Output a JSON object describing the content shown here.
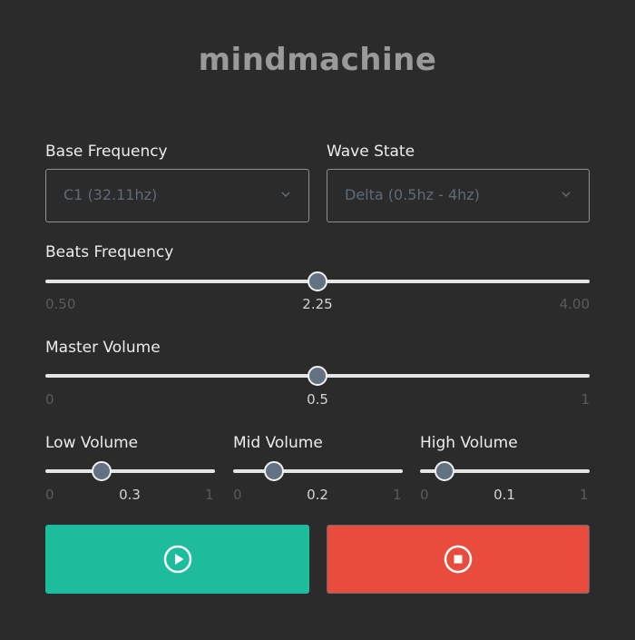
{
  "app": {
    "title": "mindmachine"
  },
  "base_frequency": {
    "label": "Base Frequency",
    "selected": "C1 (32.11hz)"
  },
  "wave_state": {
    "label": "Wave State",
    "selected": "Delta (0.5hz - 4hz)"
  },
  "beats_frequency": {
    "label": "Beats Frequency",
    "min": "0.50",
    "max": "4.00",
    "value": "2.25"
  },
  "master_volume": {
    "label": "Master Volume",
    "min": "0",
    "max": "1",
    "value": "0.5"
  },
  "low_volume": {
    "label": "Low Volume",
    "min": "0",
    "max": "1",
    "value": "0.3"
  },
  "mid_volume": {
    "label": "Mid Volume",
    "min": "0",
    "max": "1",
    "value": "0.2"
  },
  "high_volume": {
    "label": "High Volume",
    "min": "0",
    "max": "1",
    "value": "0.1"
  },
  "buttons": {
    "play_icon": "play-circle-icon",
    "stop_icon": "stop-circle-icon"
  },
  "colors": {
    "background": "#2b2b2b",
    "play_button": "#1cbc9c",
    "stop_button": "#e94c3d",
    "slider_thumb": "#627282",
    "select_text": "#5e6b78"
  }
}
